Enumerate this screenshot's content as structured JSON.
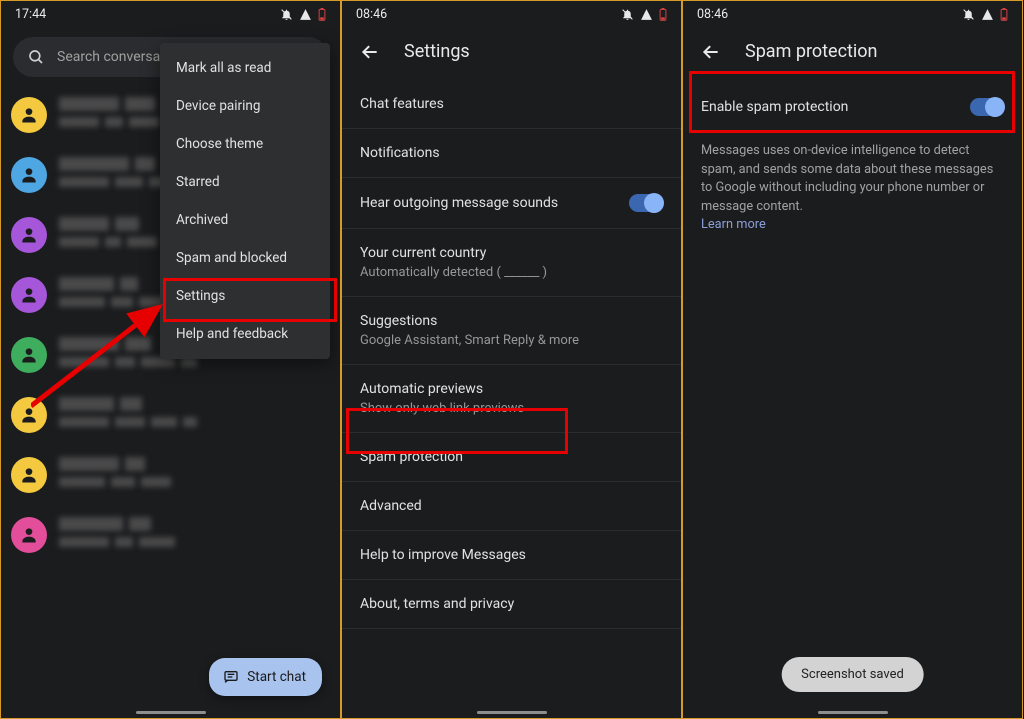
{
  "status": {
    "time_left": "17:44",
    "time_right": "08:46"
  },
  "screen1": {
    "search_placeholder": "Search conversati",
    "menu": {
      "items": [
        "Mark all as read",
        "Device pairing",
        "Choose theme",
        "Starred",
        "Archived",
        "Spam and blocked",
        "Settings",
        "Help and feedback"
      ]
    },
    "fab_label": "Start chat",
    "avatar_colors": [
      "#f4c93f",
      "#4ea7e2",
      "#a657d9",
      "#a657d9",
      "#3fad5e",
      "#f4c93f",
      "#f4c93f",
      "#e24e9a"
    ]
  },
  "screen2": {
    "title": "Settings",
    "items": [
      {
        "primary": "Chat features"
      },
      {
        "primary": "Notifications"
      },
      {
        "primary": "Hear outgoing message sounds",
        "toggle": true
      },
      {
        "primary": "Your current country",
        "secondary": "Automatically detected ( ______ )"
      },
      {
        "primary": "Suggestions",
        "secondary": "Google Assistant, Smart Reply & more"
      },
      {
        "primary": "Automatic previews",
        "secondary": "Show only web link previews"
      },
      {
        "primary": "Spam protection"
      },
      {
        "primary": "Advanced"
      },
      {
        "primary": "Help to improve Messages"
      },
      {
        "primary": "About, terms and privacy"
      }
    ]
  },
  "screen3": {
    "title": "Spam protection",
    "toggle_label": "Enable spam protection",
    "description": "Messages uses on-device intelligence to detect spam, and sends some data about these messages to Google without including your phone number or message content.",
    "learn_more": "Learn more",
    "toast": "Screenshot saved"
  }
}
